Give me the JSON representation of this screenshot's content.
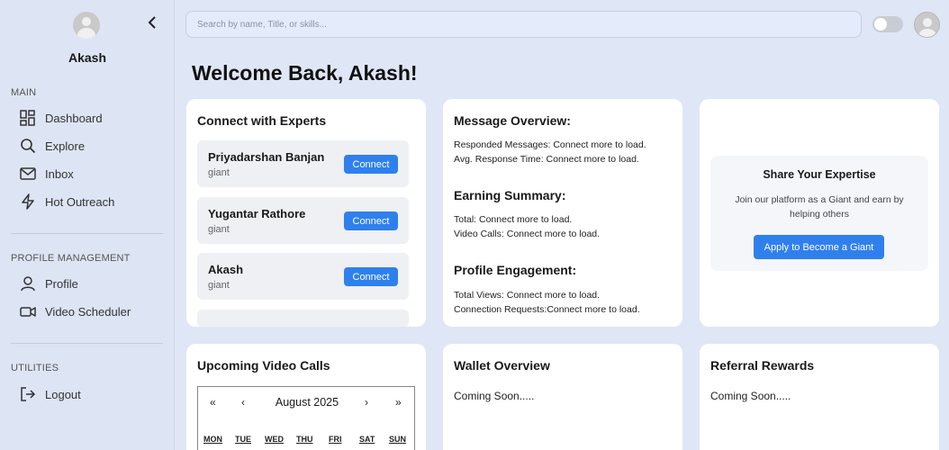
{
  "sidebar": {
    "user_name": "Akash",
    "sections": {
      "main": "MAIN",
      "profile": "PROFILE MANAGEMENT",
      "utilities": "UTILITIES"
    },
    "items": {
      "dashboard": "Dashboard",
      "explore": "Explore",
      "inbox": "Inbox",
      "outreach": "Hot Outreach",
      "profile": "Profile",
      "scheduler": "Video Scheduler",
      "logout": "Logout"
    }
  },
  "search": {
    "placeholder": "Search by name, Title, or skills..."
  },
  "welcome": "Welcome Back, Akash!",
  "experts": {
    "title": "Connect with Experts",
    "button": "Connect",
    "list": [
      {
        "name": "Priyadarshan Banjan",
        "role": "giant"
      },
      {
        "name": "Yugantar Rathore",
        "role": "giant"
      },
      {
        "name": "Akash",
        "role": "giant"
      }
    ]
  },
  "messages": {
    "overview_title": "Message Overview:",
    "responded": "Responded Messages: Connect more to load.",
    "response_time": "Avg. Response Time: Connect more to load.",
    "earning_title": "Earning Summary:",
    "total": "Total: Connect more to load.",
    "video_calls": "Video Calls: Connect more to load.",
    "engagement_title": "Profile Engagement:",
    "views": "Total Views: Connect more to load.",
    "requests": "Connection Requests:Connect more to load."
  },
  "share": {
    "title": "Share Your Expertise",
    "description": "Join our platform as a Giant and earn by helping others",
    "button": "Apply to Become a Giant"
  },
  "video_calls": {
    "title": "Upcoming Video Calls",
    "month": "August 2025",
    "nav_prev_year": "«",
    "nav_prev": "‹",
    "nav_next": "›",
    "nav_next_year": "»",
    "days": [
      "MON",
      "TUE",
      "WED",
      "THU",
      "FRI",
      "SAT",
      "SUN"
    ]
  },
  "wallet": {
    "title": "Wallet Overview",
    "text": "Coming Soon....."
  },
  "referral": {
    "title": "Referral Rewards",
    "text": "Coming Soon....."
  },
  "colors": {
    "accent": "#2f80ed",
    "background": "#dfe6f6",
    "sidebar": "#dde4f4"
  }
}
